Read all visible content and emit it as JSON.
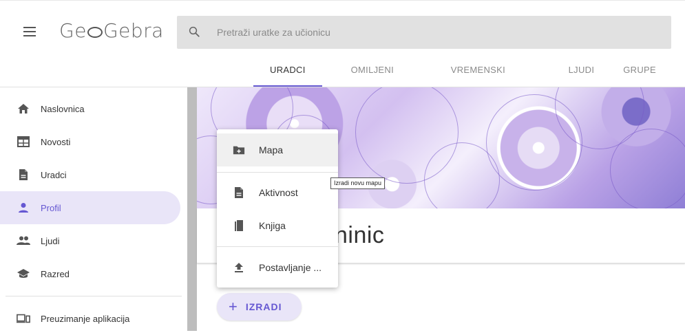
{
  "header": {
    "logo_text_pre": "Ge",
    "logo_text_post": "Gebra",
    "search_placeholder": "Pretraži uratke za učionicu",
    "icons": {
      "menu": "hamburger-icon",
      "search": "search-icon"
    }
  },
  "tabs": [
    {
      "label": "URADCI",
      "active": true
    },
    {
      "label": "OMILJENI RADOVI",
      "active": false
    },
    {
      "label": "VREMENSKI PREGLED",
      "active": false
    },
    {
      "label": "LJUDI",
      "active": false
    },
    {
      "label": "GRUPE",
      "active": false
    }
  ],
  "sidebar": {
    "items": [
      {
        "label": "Naslovnica",
        "icon": "home-icon"
      },
      {
        "label": "Novosti",
        "icon": "newspaper-icon"
      },
      {
        "label": "Uradci",
        "icon": "document-icon"
      },
      {
        "label": "Profil",
        "icon": "person-icon",
        "active": true
      },
      {
        "label": "Ljudi",
        "icon": "people-icon"
      },
      {
        "label": "Razred",
        "icon": "school-icon"
      },
      {
        "label": "Preuzimanje aplikacija",
        "icon": "devices-icon"
      }
    ]
  },
  "profile": {
    "name_visible": "ninic"
  },
  "create_button": {
    "label": "IZRADI",
    "icon": "plus-icon"
  },
  "menu": {
    "items": [
      {
        "label": "Mapa",
        "icon": "new-folder-icon"
      },
      {
        "label": "Aktivnost",
        "icon": "document-icon"
      },
      {
        "label": "Knjiga",
        "icon": "book-icon"
      },
      {
        "label": "Postavljanje ...",
        "icon": "upload-icon"
      }
    ]
  },
  "tooltip": {
    "text": "Izradi novu mapu"
  },
  "colors": {
    "accent": "#6557d2",
    "active_bg": "#e9e5f8",
    "search_bg": "#e1e1e1"
  }
}
